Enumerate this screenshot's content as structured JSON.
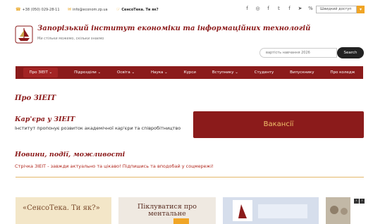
{
  "topbar": {
    "phone": "+38 (050) 029-28-11",
    "email": "info@econom.zp.ua",
    "promo": "СенсоТека. Ти як?",
    "quick_access": "Швидкий доступ"
  },
  "header": {
    "institute_name": "Запорізький інститут економіки та інформаційних технологій",
    "motto": "Ми стільки можемо, скільки знаємо",
    "search_placeholder": "вартість навчання 2026",
    "search_button": "Search"
  },
  "nav": {
    "items": [
      {
        "label": "Про ЗІЕІТ ⌄"
      },
      {
        "label": "Підрозділи ⌄"
      },
      {
        "label": "Освіта ⌄"
      },
      {
        "label": "Наука ⌄"
      },
      {
        "label": "Курси"
      },
      {
        "label": "Вступнику ⌄"
      },
      {
        "label": "Студенту"
      },
      {
        "label": "Випускнику"
      },
      {
        "label": "Про коледж"
      }
    ]
  },
  "about": {
    "title": "Про ЗІЕІТ"
  },
  "career": {
    "title": "Кар'єра у ЗІЕІТ",
    "description": "Інститут пропонує розвиток академічної кар'єри та співробітництво",
    "vacancies_button": "Вакансії"
  },
  "news": {
    "title": "Новини, події, можливості",
    "description": "Стрічка ЗІЕІТ - завжди актуально та цікаво! Підпишись та вподобай у соцмережі!"
  },
  "carousel": {
    "prev": "‹",
    "next": "›",
    "cards": [
      {
        "text": "«СенсоТека. Ти як?»"
      },
      {
        "text": "Піклуватися про ментальне"
      }
    ]
  },
  "colors": {
    "brand": "#8b1b1b",
    "accent": "#f0a526",
    "news_text": "#b1271d"
  },
  "icons": {
    "phone": "phone-icon",
    "email": "envelope-icon",
    "promo": "hand-icon",
    "social": [
      "facebook-icon",
      "instagram-icon",
      "facebook-icon",
      "twitter-icon",
      "facebook-icon",
      "telegram-icon",
      "link-icon"
    ]
  }
}
